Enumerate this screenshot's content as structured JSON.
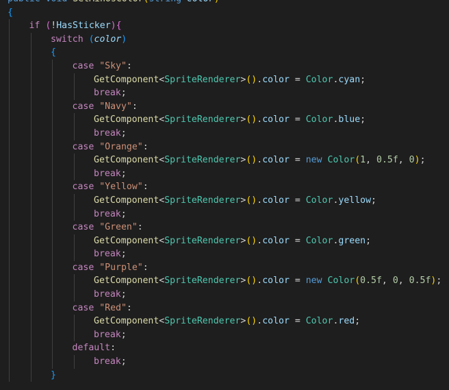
{
  "editor": {
    "colors": {
      "background": "#1e1e1e",
      "keyword": "#569cd6",
      "control": "#c586c0",
      "function": "#dcdcaa",
      "type": "#4ec9b0",
      "string": "#ce9178",
      "number": "#b5cea8",
      "variable": "#9cdcfe",
      "punct": "#d4d4d4",
      "bracket_gold": "#ffd700",
      "bracket_pink": "#da70d6",
      "bracket_blue": "#179fff",
      "indent_guide": "#404040"
    },
    "lines": [
      {
        "indent": 0,
        "tokens": [
          {
            "t": "public ",
            "c": "keyword"
          },
          {
            "t": "void ",
            "c": "keyword"
          },
          {
            "t": "SetMinosColor",
            "c": "function"
          },
          {
            "t": "(",
            "c": "bracket_gold"
          },
          {
            "t": "string ",
            "c": "keyword"
          },
          {
            "t": "color",
            "c": "variable",
            "italic": true
          },
          {
            "t": ")",
            "c": "bracket_gold"
          }
        ]
      },
      {
        "indent": 0,
        "tokens": [
          {
            "t": "{",
            "c": "bracket_blue"
          }
        ]
      },
      {
        "indent": 1,
        "tokens": [
          {
            "t": "if ",
            "c": "control"
          },
          {
            "t": "(",
            "c": "bracket_pink"
          },
          {
            "t": "!",
            "c": "punct"
          },
          {
            "t": "HasSticker",
            "c": "variable"
          },
          {
            "t": ")",
            "c": "bracket_pink"
          },
          {
            "t": "{",
            "c": "bracket_pink"
          }
        ]
      },
      {
        "indent": 2,
        "tokens": [
          {
            "t": "switch ",
            "c": "control"
          },
          {
            "t": "(",
            "c": "bracket_blue"
          },
          {
            "t": "color",
            "c": "variable",
            "italic": true
          },
          {
            "t": ")",
            "c": "bracket_blue"
          }
        ]
      },
      {
        "indent": 2,
        "tokens": [
          {
            "t": "{",
            "c": "bracket_blue"
          }
        ]
      },
      {
        "indent": 3,
        "tokens": [
          {
            "t": "case ",
            "c": "control"
          },
          {
            "t": "\"Sky\"",
            "c": "string"
          },
          {
            "t": ":",
            "c": "punct"
          }
        ]
      },
      {
        "indent": 4,
        "tokens": [
          {
            "t": "GetComponent",
            "c": "function"
          },
          {
            "t": "<",
            "c": "punct"
          },
          {
            "t": "SpriteRenderer",
            "c": "type"
          },
          {
            "t": ">",
            "c": "punct"
          },
          {
            "t": "(",
            "c": "bracket_gold"
          },
          {
            "t": ")",
            "c": "bracket_gold"
          },
          {
            "t": ".",
            "c": "punct"
          },
          {
            "t": "color",
            "c": "variable"
          },
          {
            "t": " = ",
            "c": "punct"
          },
          {
            "t": "Color",
            "c": "type"
          },
          {
            "t": ".",
            "c": "punct"
          },
          {
            "t": "cyan",
            "c": "variable"
          },
          {
            "t": ";",
            "c": "punct"
          }
        ]
      },
      {
        "indent": 4,
        "tokens": [
          {
            "t": "break",
            "c": "control"
          },
          {
            "t": ";",
            "c": "punct"
          }
        ]
      },
      {
        "indent": 3,
        "tokens": [
          {
            "t": "case ",
            "c": "control"
          },
          {
            "t": "\"Navy\"",
            "c": "string"
          },
          {
            "t": ":",
            "c": "punct"
          }
        ]
      },
      {
        "indent": 4,
        "tokens": [
          {
            "t": "GetComponent",
            "c": "function"
          },
          {
            "t": "<",
            "c": "punct"
          },
          {
            "t": "SpriteRenderer",
            "c": "type"
          },
          {
            "t": ">",
            "c": "punct"
          },
          {
            "t": "(",
            "c": "bracket_gold"
          },
          {
            "t": ")",
            "c": "bracket_gold"
          },
          {
            "t": ".",
            "c": "punct"
          },
          {
            "t": "color",
            "c": "variable"
          },
          {
            "t": " = ",
            "c": "punct"
          },
          {
            "t": "Color",
            "c": "type"
          },
          {
            "t": ".",
            "c": "punct"
          },
          {
            "t": "blue",
            "c": "variable"
          },
          {
            "t": ";",
            "c": "punct"
          }
        ]
      },
      {
        "indent": 4,
        "tokens": [
          {
            "t": "break",
            "c": "control"
          },
          {
            "t": ";",
            "c": "punct"
          }
        ]
      },
      {
        "indent": 3,
        "tokens": [
          {
            "t": "case ",
            "c": "control"
          },
          {
            "t": "\"Orange\"",
            "c": "string"
          },
          {
            "t": ":",
            "c": "punct"
          }
        ]
      },
      {
        "indent": 4,
        "tokens": [
          {
            "t": "GetComponent",
            "c": "function"
          },
          {
            "t": "<",
            "c": "punct"
          },
          {
            "t": "SpriteRenderer",
            "c": "type"
          },
          {
            "t": ">",
            "c": "punct"
          },
          {
            "t": "(",
            "c": "bracket_gold"
          },
          {
            "t": ")",
            "c": "bracket_gold"
          },
          {
            "t": ".",
            "c": "punct"
          },
          {
            "t": "color",
            "c": "variable"
          },
          {
            "t": " = ",
            "c": "punct"
          },
          {
            "t": "new ",
            "c": "keyword"
          },
          {
            "t": "Color",
            "c": "type"
          },
          {
            "t": "(",
            "c": "bracket_gold"
          },
          {
            "t": "1",
            "c": "number"
          },
          {
            "t": ", ",
            "c": "punct"
          },
          {
            "t": "0.5f",
            "c": "number"
          },
          {
            "t": ", ",
            "c": "punct"
          },
          {
            "t": "0",
            "c": "number"
          },
          {
            "t": ")",
            "c": "bracket_gold"
          },
          {
            "t": ";",
            "c": "punct"
          }
        ]
      },
      {
        "indent": 4,
        "tokens": [
          {
            "t": "break",
            "c": "control"
          },
          {
            "t": ";",
            "c": "punct"
          }
        ]
      },
      {
        "indent": 3,
        "tokens": [
          {
            "t": "case ",
            "c": "control"
          },
          {
            "t": "\"Yellow\"",
            "c": "string"
          },
          {
            "t": ":",
            "c": "punct"
          }
        ]
      },
      {
        "indent": 4,
        "tokens": [
          {
            "t": "GetComponent",
            "c": "function"
          },
          {
            "t": "<",
            "c": "punct"
          },
          {
            "t": "SpriteRenderer",
            "c": "type"
          },
          {
            "t": ">",
            "c": "punct"
          },
          {
            "t": "(",
            "c": "bracket_gold"
          },
          {
            "t": ")",
            "c": "bracket_gold"
          },
          {
            "t": ".",
            "c": "punct"
          },
          {
            "t": "color",
            "c": "variable"
          },
          {
            "t": " = ",
            "c": "punct"
          },
          {
            "t": "Color",
            "c": "type"
          },
          {
            "t": ".",
            "c": "punct"
          },
          {
            "t": "yellow",
            "c": "variable"
          },
          {
            "t": ";",
            "c": "punct"
          }
        ]
      },
      {
        "indent": 4,
        "tokens": [
          {
            "t": "break",
            "c": "control"
          },
          {
            "t": ";",
            "c": "punct"
          }
        ]
      },
      {
        "indent": 3,
        "tokens": [
          {
            "t": "case ",
            "c": "control"
          },
          {
            "t": "\"Green\"",
            "c": "string"
          },
          {
            "t": ":",
            "c": "punct"
          }
        ]
      },
      {
        "indent": 4,
        "tokens": [
          {
            "t": "GetComponent",
            "c": "function"
          },
          {
            "t": "<",
            "c": "punct"
          },
          {
            "t": "SpriteRenderer",
            "c": "type"
          },
          {
            "t": ">",
            "c": "punct"
          },
          {
            "t": "(",
            "c": "bracket_gold"
          },
          {
            "t": ")",
            "c": "bracket_gold"
          },
          {
            "t": ".",
            "c": "punct"
          },
          {
            "t": "color",
            "c": "variable"
          },
          {
            "t": " = ",
            "c": "punct"
          },
          {
            "t": "Color",
            "c": "type"
          },
          {
            "t": ".",
            "c": "punct"
          },
          {
            "t": "green",
            "c": "variable"
          },
          {
            "t": ";",
            "c": "punct"
          }
        ]
      },
      {
        "indent": 4,
        "tokens": [
          {
            "t": "break",
            "c": "control"
          },
          {
            "t": ";",
            "c": "punct"
          }
        ]
      },
      {
        "indent": 3,
        "tokens": [
          {
            "t": "case ",
            "c": "control"
          },
          {
            "t": "\"Purple\"",
            "c": "string"
          },
          {
            "t": ":",
            "c": "punct"
          }
        ]
      },
      {
        "indent": 4,
        "tokens": [
          {
            "t": "GetComponent",
            "c": "function"
          },
          {
            "t": "<",
            "c": "punct"
          },
          {
            "t": "SpriteRenderer",
            "c": "type"
          },
          {
            "t": ">",
            "c": "punct"
          },
          {
            "t": "(",
            "c": "bracket_gold"
          },
          {
            "t": ")",
            "c": "bracket_gold"
          },
          {
            "t": ".",
            "c": "punct"
          },
          {
            "t": "color",
            "c": "variable"
          },
          {
            "t": " = ",
            "c": "punct"
          },
          {
            "t": "new ",
            "c": "keyword"
          },
          {
            "t": "Color",
            "c": "type"
          },
          {
            "t": "(",
            "c": "bracket_gold"
          },
          {
            "t": "0.5f",
            "c": "number"
          },
          {
            "t": ", ",
            "c": "punct"
          },
          {
            "t": "0",
            "c": "number"
          },
          {
            "t": ", ",
            "c": "punct"
          },
          {
            "t": "0.5f",
            "c": "number"
          },
          {
            "t": ")",
            "c": "bracket_gold"
          },
          {
            "t": ";",
            "c": "punct"
          }
        ]
      },
      {
        "indent": 4,
        "tokens": [
          {
            "t": "break",
            "c": "control"
          },
          {
            "t": ";",
            "c": "punct"
          }
        ]
      },
      {
        "indent": 3,
        "tokens": [
          {
            "t": "case ",
            "c": "control"
          },
          {
            "t": "\"Red\"",
            "c": "string"
          },
          {
            "t": ":",
            "c": "punct"
          }
        ]
      },
      {
        "indent": 4,
        "tokens": [
          {
            "t": "GetComponent",
            "c": "function"
          },
          {
            "t": "<",
            "c": "punct"
          },
          {
            "t": "SpriteRenderer",
            "c": "type"
          },
          {
            "t": ">",
            "c": "punct"
          },
          {
            "t": "(",
            "c": "bracket_gold"
          },
          {
            "t": ")",
            "c": "bracket_gold"
          },
          {
            "t": ".",
            "c": "punct"
          },
          {
            "t": "color",
            "c": "variable"
          },
          {
            "t": " = ",
            "c": "punct"
          },
          {
            "t": "Color",
            "c": "type"
          },
          {
            "t": ".",
            "c": "punct"
          },
          {
            "t": "red",
            "c": "variable"
          },
          {
            "t": ";",
            "c": "punct"
          }
        ]
      },
      {
        "indent": 4,
        "tokens": [
          {
            "t": "break",
            "c": "control"
          },
          {
            "t": ";",
            "c": "punct"
          }
        ]
      },
      {
        "indent": 3,
        "tokens": [
          {
            "t": "default",
            "c": "control"
          },
          {
            "t": ":",
            "c": "punct"
          }
        ]
      },
      {
        "indent": 4,
        "tokens": [
          {
            "t": "break",
            "c": "control"
          },
          {
            "t": ";",
            "c": "punct"
          }
        ]
      },
      {
        "indent": 2,
        "tokens": [
          {
            "t": "}",
            "c": "bracket_blue"
          }
        ]
      }
    ]
  }
}
